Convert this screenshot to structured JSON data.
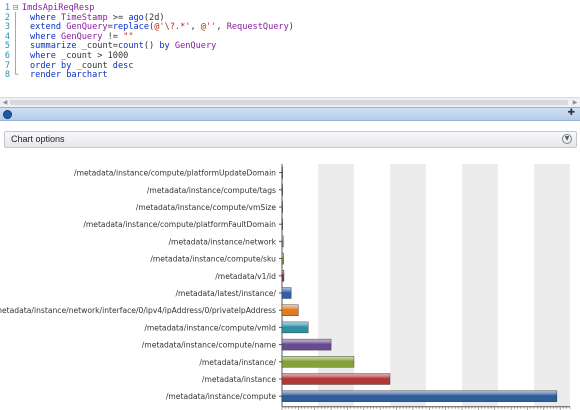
{
  "editor": {
    "lines": [
      {
        "num": "1",
        "tokens": [
          {
            "t": "ImdsApiReqResp",
            "c": "id"
          }
        ]
      },
      {
        "num": "2",
        "tokens": [
          {
            "t": "where ",
            "c": "kw"
          },
          {
            "t": "TimeStamp",
            "c": "id"
          },
          {
            "t": " >= ",
            "c": "op"
          },
          {
            "t": "ago",
            "c": "fn"
          },
          {
            "t": "(2d)",
            "c": "txt"
          }
        ]
      },
      {
        "num": "3",
        "tokens": [
          {
            "t": "extend ",
            "c": "kw"
          },
          {
            "t": "GenQuery",
            "c": "id"
          },
          {
            "t": "=",
            "c": "op"
          },
          {
            "t": "replace",
            "c": "fn"
          },
          {
            "t": "(",
            "c": "txt"
          },
          {
            "t": "@'\\?.*'",
            "c": "str"
          },
          {
            "t": ", ",
            "c": "txt"
          },
          {
            "t": "@''",
            "c": "str"
          },
          {
            "t": ", ",
            "c": "txt"
          },
          {
            "t": "RequestQuery",
            "c": "id"
          },
          {
            "t": ")",
            "c": "txt"
          }
        ]
      },
      {
        "num": "4",
        "tokens": [
          {
            "t": "where ",
            "c": "kw"
          },
          {
            "t": "GenQuery",
            "c": "id"
          },
          {
            "t": " != ",
            "c": "op"
          },
          {
            "t": "\"\"",
            "c": "str"
          }
        ]
      },
      {
        "num": "5",
        "tokens": [
          {
            "t": "summarize ",
            "c": "kw"
          },
          {
            "t": "_count=",
            "c": "txt"
          },
          {
            "t": "count",
            "c": "fn"
          },
          {
            "t": "() ",
            "c": "txt"
          },
          {
            "t": "by ",
            "c": "kw"
          },
          {
            "t": "GenQuery",
            "c": "id"
          }
        ]
      },
      {
        "num": "6",
        "tokens": [
          {
            "t": "where ",
            "c": "kw"
          },
          {
            "t": "_count > 1000",
            "c": "txt"
          }
        ]
      },
      {
        "num": "7",
        "tokens": [
          {
            "t": "order ",
            "c": "kw"
          },
          {
            "t": "by ",
            "c": "kw"
          },
          {
            "t": "_count ",
            "c": "txt"
          },
          {
            "t": "desc",
            "c": "kw"
          }
        ]
      },
      {
        "num": "8",
        "tokens": [
          {
            "t": "render ",
            "c": "kw"
          },
          {
            "t": "barchart",
            "c": "kw"
          }
        ]
      }
    ]
  },
  "results": {
    "chart_options_label": "Chart options"
  },
  "chart_data": {
    "type": "bar",
    "orientation": "horizontal",
    "categories": [
      "/metadata/instance/compute/platformUpdateDomain",
      "/metadata/instance/compute/tags",
      "/metadata/instance/compute/vmSize",
      "/metadata/instance/compute/platformFaultDomain",
      "/metadata/instance/network",
      "/metadata/instance/compute/sku",
      "/metadata/v1/id",
      "/metadata/latest/instance/",
      "/metadata/instance/network/interface/0/ipv4/ipAddress/0/privateIpAddress",
      "/metadata/instance/compute/vmId",
      "/metadata/instance/compute/name",
      "/metadata/instance/",
      "/metadata/instance",
      "/metadata/instance/compute"
    ],
    "values": [
      0.1,
      0.1,
      0.2,
      0.2,
      0.4,
      0.5,
      0.6,
      2.8,
      5.0,
      8.0,
      15.0,
      22.0,
      33.0,
      84.0
    ],
    "colors": [
      "#7b7b7b",
      "#7b7b7b",
      "#7b7b7b",
      "#7b7b7b",
      "#7b7b7b",
      "#8a9a40",
      "#8a3838",
      "#2f5fa6",
      "#e07a24",
      "#2e8fa5",
      "#6a4a8e",
      "#86a13a",
      "#b0373a",
      "#2f5c9a"
    ],
    "xlim": [
      0,
      88
    ],
    "grid": true,
    "title": "",
    "xlabel": "",
    "ylabel": ""
  }
}
